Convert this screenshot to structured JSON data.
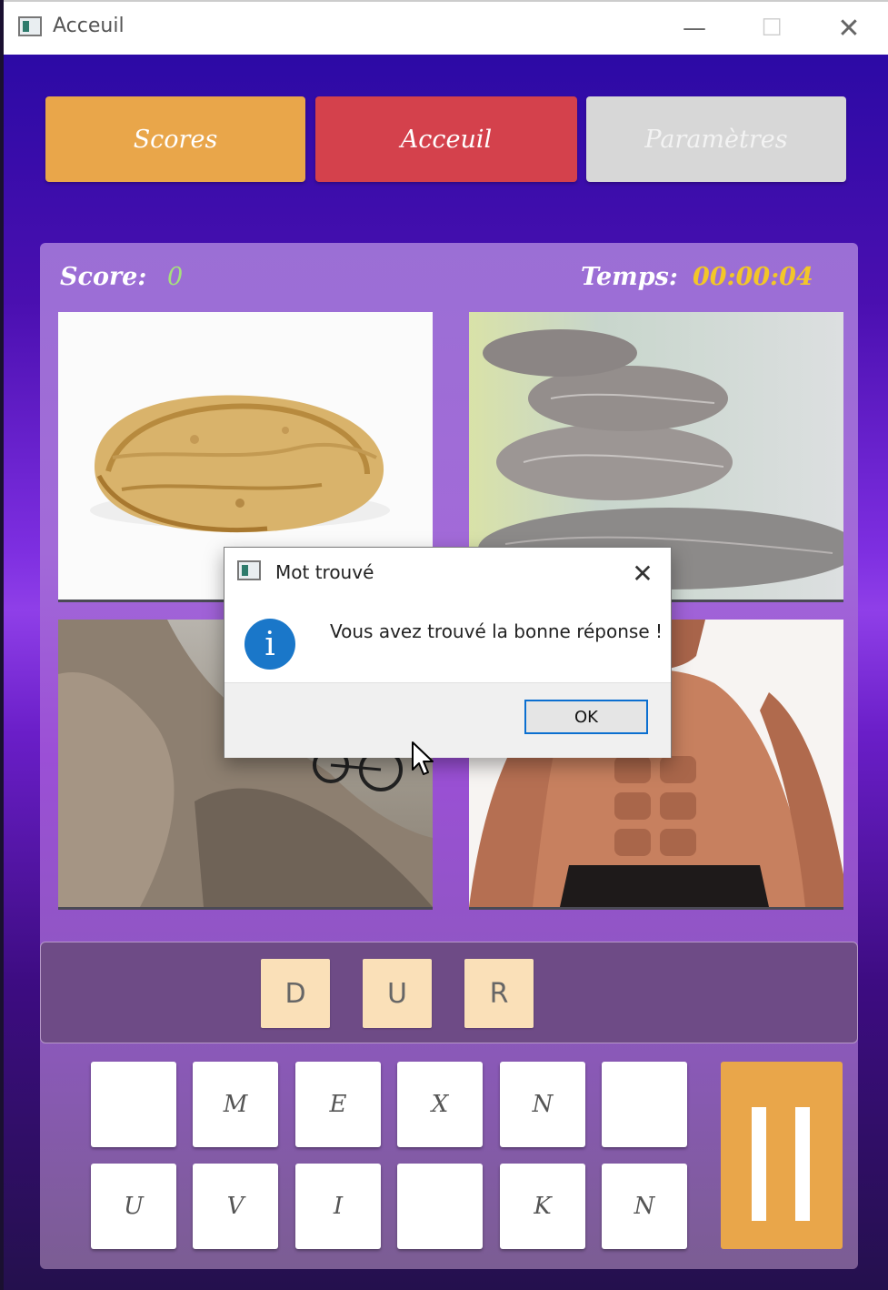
{
  "window": {
    "title": "Acceuil",
    "minimize_glyph": "—",
    "maximize_glyph": "☐",
    "close_glyph": "✕"
  },
  "nav": {
    "scores": "Scores",
    "home": "Acceuil",
    "settings": "Paramètres"
  },
  "status": {
    "score_label": "Score:",
    "score_value": "0",
    "time_label": "Temps:",
    "time_value": "00:00:04"
  },
  "images": [
    "walnut",
    "stacked-stones",
    "rock-cliff",
    "muscular-man"
  ],
  "answer": {
    "letters": [
      "D",
      "U",
      "R"
    ]
  },
  "keyboard": {
    "row1": [
      "",
      "M",
      "E",
      "X",
      "N",
      ""
    ],
    "row2": [
      "U",
      "V",
      "I",
      "",
      "K",
      "N"
    ]
  },
  "dialog": {
    "title": "Mot trouvé",
    "message": "Vous avez trouvé la bonne réponse !",
    "ok_label": "OK",
    "icon_glyph": "i",
    "close_glyph": "✕"
  },
  "colors": {
    "scores_button": "#e9a64a",
    "home_button": "#d4414c",
    "settings_button": "#d7d7d7",
    "score_value": "#a6e07c",
    "time_value": "#f2c629",
    "answer_slot": "#fae0b8",
    "info_icon": "#1a77c9"
  }
}
